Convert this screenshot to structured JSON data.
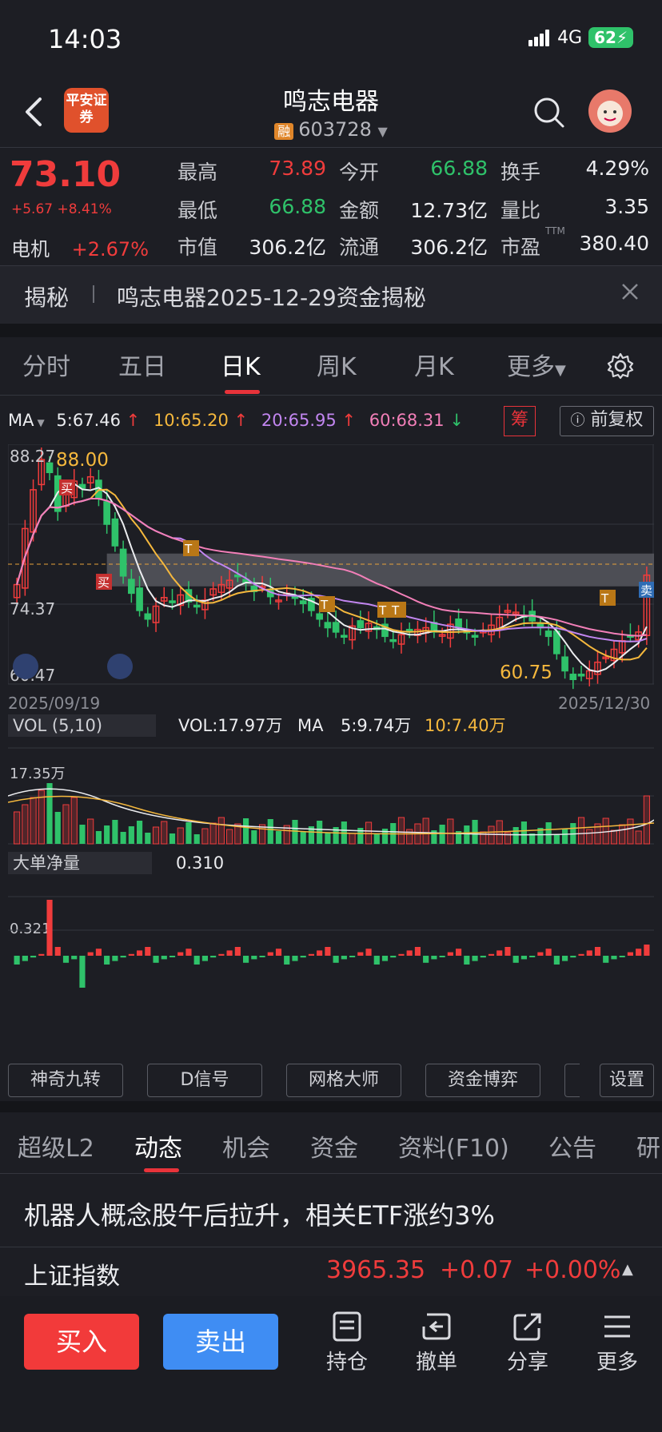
{
  "status": {
    "time": "14:03",
    "network": "4G",
    "battery": "62"
  },
  "header": {
    "logo_text": "平安证券",
    "stock_name": "鸣志电器",
    "rong_badge": "融",
    "code": "603728"
  },
  "quote": {
    "price": "73.10",
    "change": "+5.67 +8.41%",
    "sector_name": "电机",
    "sector_change": "+2.67%",
    "cells": [
      {
        "label": "最高",
        "value": "73.89",
        "color": "red"
      },
      {
        "label": "今开",
        "value": "66.88",
        "color": "green"
      },
      {
        "label": "换手",
        "value": "4.29%",
        "color": "white"
      },
      {
        "label": "最低",
        "value": "66.88",
        "color": "green"
      },
      {
        "label": "金额",
        "value": "12.73亿",
        "color": "white"
      },
      {
        "label": "量比",
        "value": "3.35",
        "color": "white"
      },
      {
        "label": "市值",
        "value": "306.2亿",
        "color": "white"
      },
      {
        "label": "流通",
        "value": "306.2亿",
        "color": "white"
      },
      {
        "label": "市盈",
        "value": "380.40",
        "color": "white",
        "sup": "TTM"
      }
    ]
  },
  "notice": {
    "tag": "揭秘",
    "text": "鸣志电器2025-12-29资金揭秘"
  },
  "period_tabs": [
    "分时",
    "五日",
    "日K",
    "周K",
    "月K",
    "更多"
  ],
  "active_period": "日K",
  "ma": {
    "label": "MA",
    "items": [
      {
        "text": "5:67.46",
        "color": "#ecedf0"
      },
      {
        "text": "10:65.20",
        "color": "#f5b83d"
      },
      {
        "text": "20:65.95",
        "color": "#c286f0"
      },
      {
        "text": "60:68.31",
        "color": "#f27fb8",
        "down": true
      }
    ],
    "chou": "筹",
    "fuquan": "前复权"
  },
  "chart": {
    "y_top_label": "88.27",
    "y_mid_label": "74.37",
    "y_bottom_label": "60.47",
    "high_marker": "88.00",
    "low_marker": "60.75",
    "date_start": "2025/09/19",
    "date_end": "2025/12/30",
    "buy_tag": "买",
    "sell_tag": "卖",
    "t_tag": "T"
  },
  "chart_data": {
    "type": "candlestick",
    "x_start": "2025/09/19",
    "x_end": "2025/12/30",
    "ylim": [
      60.47,
      88.27
    ],
    "high": 88.0,
    "low": 60.75,
    "close": [
      72.0,
      78.5,
      83.0,
      86.5,
      85.0,
      80.5,
      82.5,
      84.0,
      83.2,
      84.5,
      82.0,
      79.0,
      76.5,
      73.0,
      71.0,
      69.0,
      68.0,
      69.5,
      70.5,
      70.0,
      70.8,
      70.0,
      69.5,
      70.2,
      71.5,
      72.0,
      72.5,
      73.0,
      72.2,
      71.2,
      71.8,
      70.6,
      70.2,
      71.0,
      70.5,
      69.8,
      69.0,
      68.0,
      67.0,
      66.5,
      66.0,
      67.2,
      67.0,
      67.5,
      66.8,
      66.0,
      65.5,
      66.2,
      66.5,
      66.8,
      67.0,
      66.5,
      66.2,
      67.4,
      67.0,
      66.5,
      66.0,
      66.6,
      67.3,
      68.2,
      69.0,
      68.8,
      68.3,
      67.8,
      67.0,
      66.0,
      64.0,
      62.0,
      61.0,
      61.5,
      62.0,
      63.0,
      63.6,
      64.5,
      65.5,
      66.0,
      66.5,
      73.1
    ],
    "volume": {
      "vol": "17.97万",
      "ma5": "9.74万",
      "ma10": "7.40万",
      "axis_label": "17.35万"
    },
    "big_order_net": {
      "value": "0.310",
      "axis_label": "0.321"
    }
  },
  "vol_header": {
    "label": "VOL (5,10)",
    "vol": "VOL:17.97万",
    "ma": "MA",
    "ma5": "5:9.74万",
    "ma10": "10:7.40万",
    "axis": "17.35万"
  },
  "big_order_header": {
    "label": "大单净量",
    "value": "0.310",
    "axis": "0.321"
  },
  "tools": [
    "神奇九转",
    "D信号",
    "网格大师",
    "资金博弈",
    "",
    "设置"
  ],
  "bottom_tabs": [
    "超级L2",
    "动态",
    "机会",
    "资金",
    "资料(F10)",
    "公告",
    "研"
  ],
  "active_bottom_tab": "动态",
  "news": "机器人概念股午后拉升，相关ETF涨约3%",
  "index": {
    "name": "上证指数",
    "value": "3965.35",
    "change": "+0.07",
    "pct": "+0.00%"
  },
  "trade": {
    "buy": "买入",
    "sell": "卖出",
    "hold": "持仓",
    "cancel": "撤单",
    "share": "分享",
    "more": "更多"
  }
}
